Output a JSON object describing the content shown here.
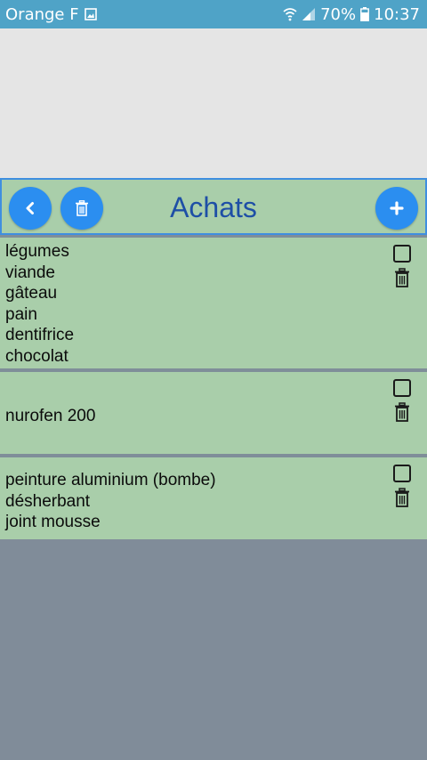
{
  "status_bar": {
    "carrier": "Orange F",
    "battery": "70%",
    "time": "10:37"
  },
  "header": {
    "title": "Achats",
    "back_icon": "chevron-left-icon",
    "delete_icon": "trash-icon",
    "add_icon": "plus-icon"
  },
  "colors": {
    "status_bar": "#4fa3c7",
    "card_background": "#a9ceaa",
    "button_blue": "#2b8ef0",
    "title_blue": "#1e4fa6",
    "empty_area": "#808c99"
  },
  "lists": [
    {
      "items": [
        "légumes",
        "viande",
        "gâteau",
        "pain",
        "dentifrice",
        "chocolat"
      ],
      "checked": false
    },
    {
      "items": [
        "nurofen 200"
      ],
      "checked": false
    },
    {
      "items": [
        "peinture aluminium (bombe)",
        "désherbant",
        "joint mousse"
      ],
      "checked": false
    }
  ]
}
